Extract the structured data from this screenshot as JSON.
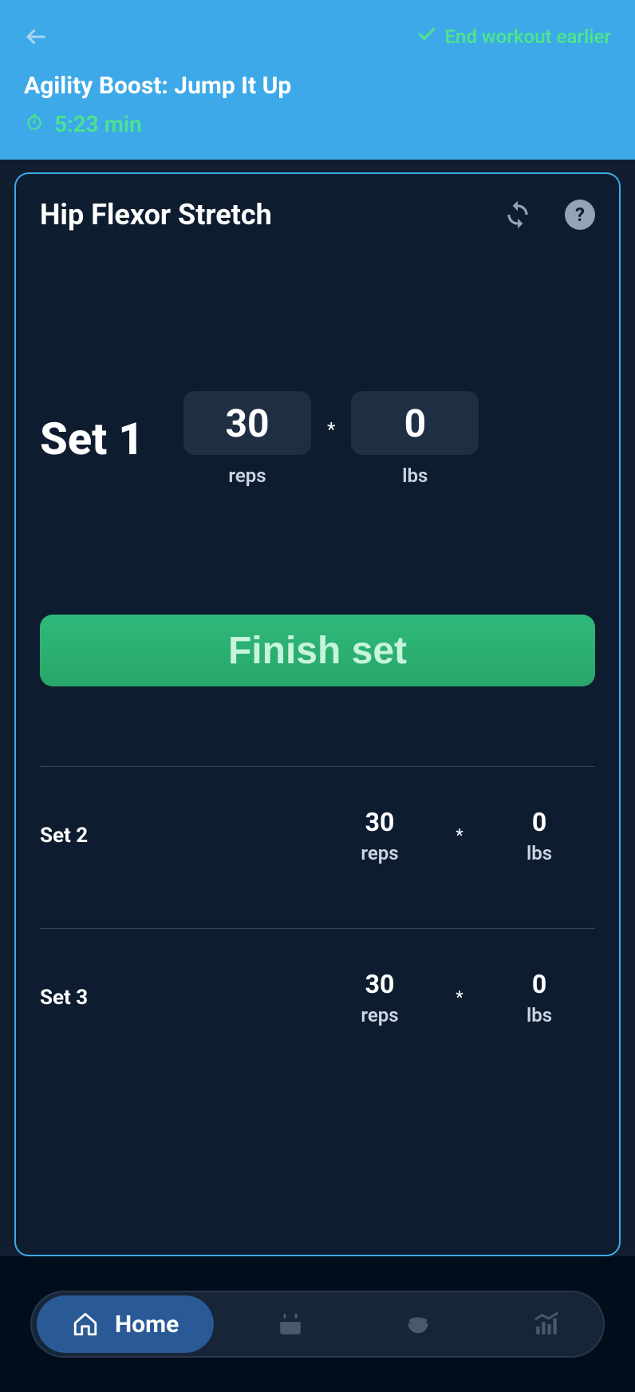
{
  "header": {
    "end_workout_label": "End workout earlier",
    "workout_title": "Agility Boost: Jump It Up",
    "timer": "5:23 min"
  },
  "exercise": {
    "name": "Hip Flexor Stretch",
    "finish_button": "Finish set"
  },
  "current_set": {
    "label": "Set 1",
    "reps": "30",
    "reps_unit": "reps",
    "weight": "0",
    "weight_unit": "lbs"
  },
  "other_sets": [
    {
      "label": "Set 2",
      "reps": "30",
      "reps_unit": "reps",
      "weight": "0",
      "weight_unit": "lbs"
    },
    {
      "label": "Set 3",
      "reps": "30",
      "reps_unit": "reps",
      "weight": "0",
      "weight_unit": "lbs"
    }
  ],
  "nav": {
    "home_label": "Home"
  }
}
